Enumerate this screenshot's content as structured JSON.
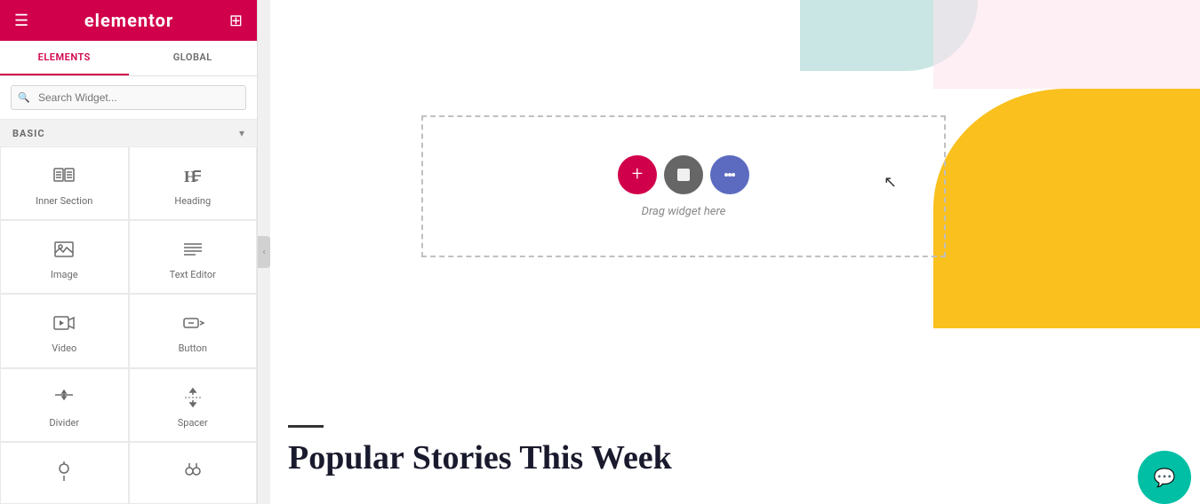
{
  "sidebar": {
    "logo": "elementor",
    "tabs": [
      {
        "id": "elements",
        "label": "ELEMENTS",
        "active": true
      },
      {
        "id": "global",
        "label": "GLOBAL",
        "active": false
      }
    ],
    "search": {
      "placeholder": "Search Widget..."
    },
    "section": {
      "title": "BASIC",
      "chevron": "▾"
    },
    "widgets": [
      {
        "id": "inner-section",
        "label": "Inner Section",
        "icon": "inner-section-icon"
      },
      {
        "id": "heading",
        "label": "Heading",
        "icon": "heading-icon"
      },
      {
        "id": "image",
        "label": "Image",
        "icon": "image-icon"
      },
      {
        "id": "text-editor",
        "label": "Text Editor",
        "icon": "text-editor-icon"
      },
      {
        "id": "video",
        "label": "Video",
        "icon": "video-icon"
      },
      {
        "id": "button",
        "label": "Button",
        "icon": "button-icon"
      },
      {
        "id": "divider",
        "label": "Divider",
        "icon": "divider-icon"
      },
      {
        "id": "spacer",
        "label": "Spacer",
        "icon": "spacer-icon"
      },
      {
        "id": "widget9",
        "label": "",
        "icon": "widget9-icon"
      },
      {
        "id": "widget10",
        "label": "",
        "icon": "widget10-icon"
      }
    ]
  },
  "canvas": {
    "drop_zone": {
      "label": "Drag widget here"
    },
    "actions": [
      {
        "id": "add",
        "symbol": "+",
        "color": "#d1004b"
      },
      {
        "id": "gray",
        "symbol": "■",
        "color": "#666666"
      },
      {
        "id": "purple",
        "symbol": "⚙",
        "color": "#5c6bc0"
      }
    ],
    "popular_stories": {
      "heading": "Popular Stories This Week"
    },
    "chat_button": "💬"
  }
}
